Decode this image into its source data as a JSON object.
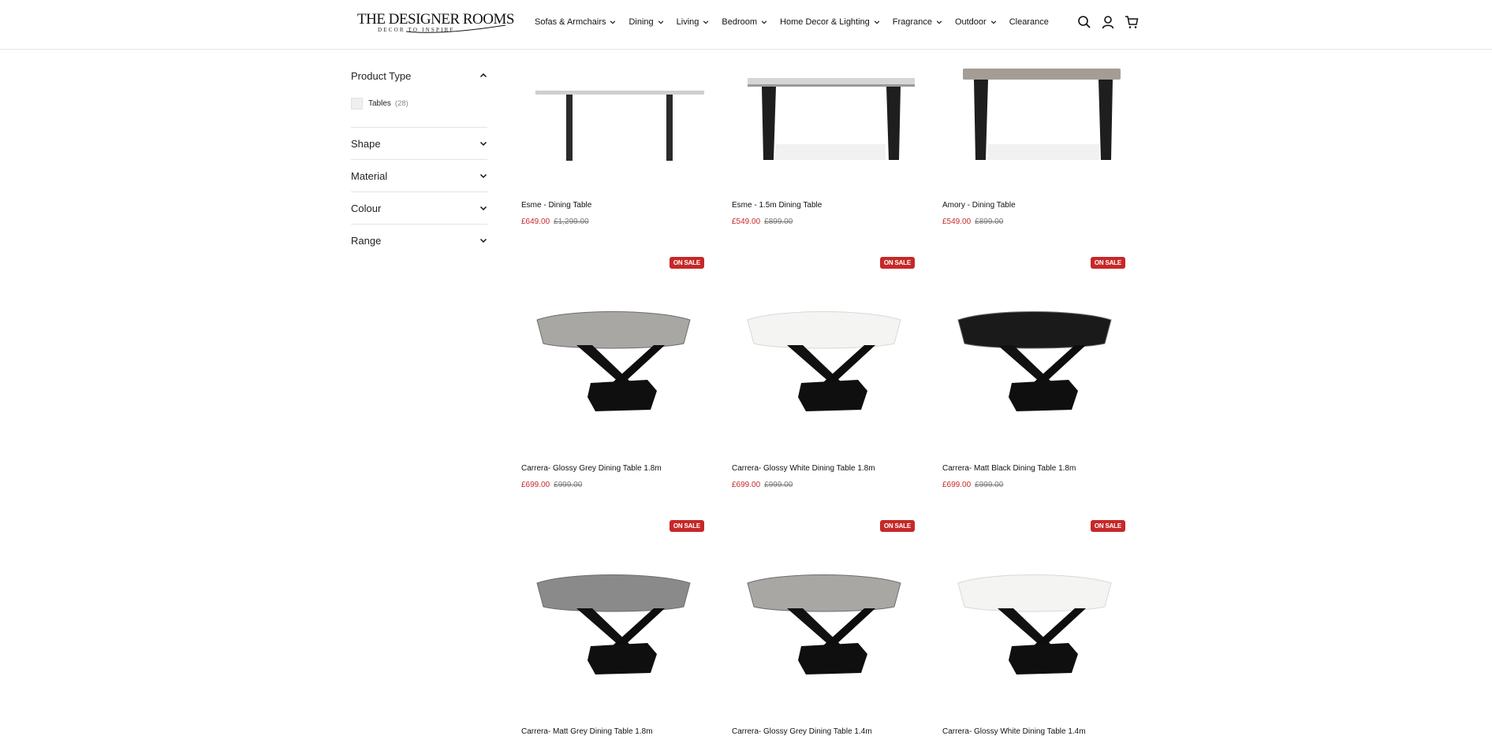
{
  "brand": {
    "logo_main": "THE DESIGNER ROOMS",
    "logo_tagline": "DECOR TO INSPIRE"
  },
  "nav": [
    {
      "label": "Sofas & Armchairs"
    },
    {
      "label": "Dining"
    },
    {
      "label": "Living"
    },
    {
      "label": "Bedroom"
    },
    {
      "label": "Home Decor & Lighting"
    },
    {
      "label": "Fragrance"
    },
    {
      "label": "Outdoor"
    },
    {
      "label": "Clearance"
    }
  ],
  "header_icons": [
    "search-icon",
    "account-icon",
    "cart-icon"
  ],
  "filters": [
    {
      "label": "Product Type",
      "open": true,
      "options": [
        {
          "label": "Tables",
          "count": "(28)"
        }
      ]
    },
    {
      "label": "Shape",
      "open": false
    },
    {
      "label": "Material",
      "open": false
    },
    {
      "label": "Colour",
      "open": false
    },
    {
      "label": "Range",
      "open": false
    }
  ],
  "badge_label": "ON SALE",
  "colors": {
    "sale": "#c62828",
    "badge": "#c62828"
  },
  "products": [
    {
      "name": "Esme - Dining Table",
      "price": "£649.00",
      "old_price": "£1,299.00",
      "sale_badge": false,
      "style": "esme-thin"
    },
    {
      "name": "Esme - 1.5m Dining Table",
      "price": "£549.00",
      "old_price": "£899.00",
      "sale_badge": false,
      "style": "esme-white"
    },
    {
      "name": "Amory - Dining Table",
      "price": "£549.00",
      "old_price": "£899.00",
      "sale_badge": false,
      "style": "amory"
    },
    {
      "name": "Carrera- Glossy Grey Dining Table 1.8m",
      "price": "£699.00",
      "old_price": "£999.00",
      "sale_badge": true,
      "style": "carrera-grey"
    },
    {
      "name": "Carrera- Glossy White Dining Table 1.8m",
      "price": "£699.00",
      "old_price": "£999.00",
      "sale_badge": true,
      "style": "carrera-white"
    },
    {
      "name": "Carrera- Matt Black Dining Table 1.8m",
      "price": "£699.00",
      "old_price": "£999.00",
      "sale_badge": true,
      "style": "carrera-black"
    },
    {
      "name": "Carrera- Matt Grey Dining Table 1.8m",
      "price": "",
      "old_price": "",
      "sale_badge": true,
      "style": "carrera-mattgrey"
    },
    {
      "name": "Carrera- Glossy Grey Dining Table 1.4m",
      "price": "",
      "old_price": "",
      "sale_badge": true,
      "style": "carrera-grey"
    },
    {
      "name": "Carrera- Glossy White Dining Table 1.4m",
      "price": "",
      "old_price": "",
      "sale_badge": true,
      "style": "carrera-white"
    }
  ]
}
